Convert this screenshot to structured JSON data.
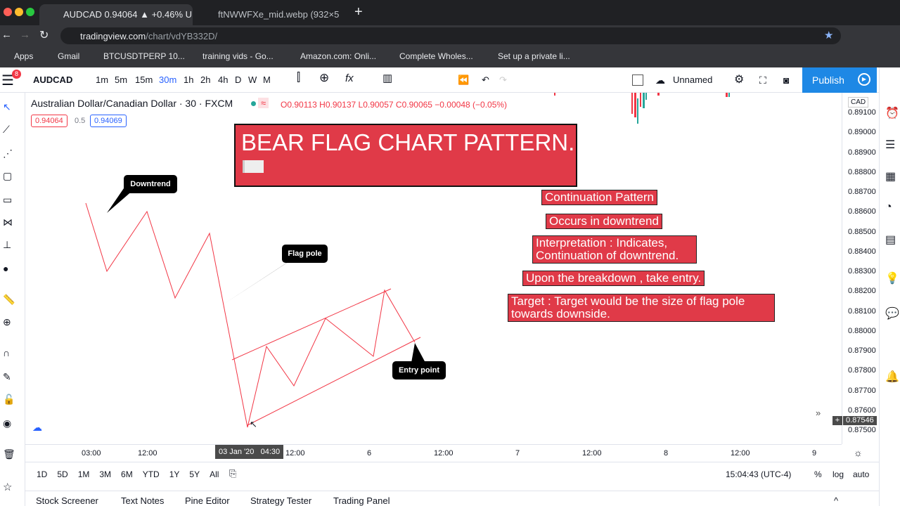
{
  "browser": {
    "tabs": [
      {
        "title": "AUDCAD 0.94064 ▲ +0.46% U"
      },
      {
        "title": "ftNWWFXe_mid.webp (932×5"
      }
    ],
    "url_domain": "tradingview.com",
    "url_path": "/chart/vdYB332D/",
    "bookmarks": [
      "Apps",
      "Gmail",
      "BTCUSDTPERP 10...",
      "training vids - Go...",
      "Amazon.com: Onli...",
      "Complete Wholes...",
      "Set up a private li..."
    ]
  },
  "toolbar": {
    "badge": "8",
    "symbol": "AUDCAD",
    "intervals": [
      "1m",
      "5m",
      "15m",
      "30m",
      "1h",
      "2h",
      "4h",
      "D",
      "W",
      "M"
    ],
    "active_interval": "30m",
    "layout_name": "Unnamed",
    "publish": "Publish"
  },
  "legend": {
    "title": "Australian Dollar/Canadian Dollar · 30 · FXCM",
    "ohlc": "O0.90113 H0.90137 L0.90057 C0.90065 −0.00048 (−0.05%)",
    "bid": "0.94064",
    "spread": "0.5",
    "ask": "0.94069"
  },
  "price_axis": {
    "currency": "CAD",
    "labels": [
      "0.89100",
      "0.89000",
      "0.88900",
      "0.88800",
      "0.88700",
      "0.88600",
      "0.88500",
      "0.88400",
      "0.88300",
      "0.88200",
      "0.88100",
      "0.88000",
      "0.87900",
      "0.87800",
      "0.87700",
      "0.87600",
      "0.87500"
    ],
    "current": "0.87546"
  },
  "time_axis": {
    "labels": [
      "03:00",
      "12:00",
      "12:00",
      "6",
      "12:00",
      "7",
      "12:00",
      "8",
      "12:00",
      "9"
    ],
    "cursor": "03 Jan '20   04:30"
  },
  "range": {
    "buttons": [
      "1D",
      "5D",
      "1M",
      "3M",
      "6M",
      "YTD",
      "1Y",
      "5Y",
      "All"
    ],
    "clock": "15:04:43 (UTC-4)",
    "pct": "%",
    "log": "log",
    "auto": "auto"
  },
  "bottom_tabs": [
    "Stock Screener",
    "Text Notes",
    "Pine Editor",
    "Strategy Tester",
    "Trading Panel"
  ],
  "annotations": {
    "title": "BEAR FLAG CHART PATTERN.",
    "points": [
      "Continuation Pattern",
      "Occurs in downtrend",
      "Interpretation : Indicates, Continuation of downtrend.",
      "Upon the breakdown , take entry.",
      "Target : Target would be the size of flag pole towards downside."
    ],
    "callouts": {
      "downtrend": "Downtrend",
      "flag_pole": "Flag pole",
      "entry": "Entry point"
    }
  },
  "colors": {
    "accent": "#2962ff",
    "publish": "#1e88e5",
    "red": "#e03a48",
    "line": "#f23645"
  }
}
